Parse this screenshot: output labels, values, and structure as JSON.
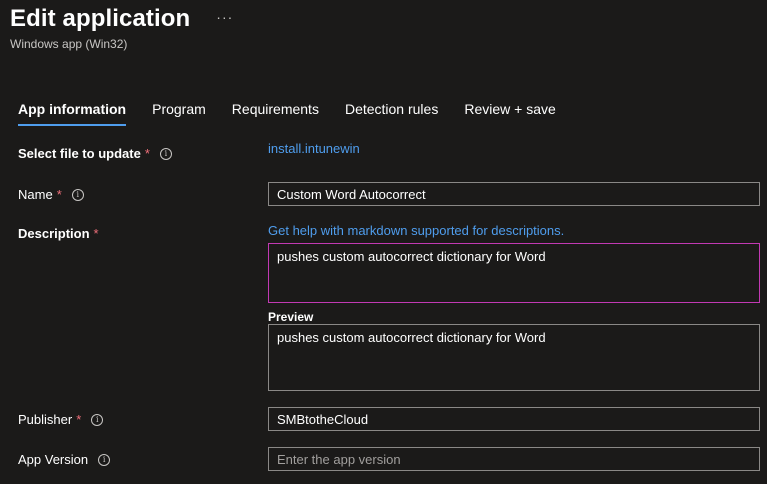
{
  "header": {
    "title": "Edit application",
    "more_label": "···",
    "subtitle": "Windows app (Win32)"
  },
  "tabs": [
    {
      "label": "App information",
      "active": true
    },
    {
      "label": "Program",
      "active": false
    },
    {
      "label": "Requirements",
      "active": false
    },
    {
      "label": "Detection rules",
      "active": false
    },
    {
      "label": "Review + save",
      "active": false
    }
  ],
  "form": {
    "select_file": {
      "label": "Select file to update",
      "required_mark": "*",
      "value": "install.intunewin"
    },
    "name": {
      "label": "Name",
      "required_mark": "*",
      "value": "Custom Word Autocorrect"
    },
    "description": {
      "label": "Description",
      "required_mark": "*",
      "help_link": "Get help with markdown supported for descriptions.",
      "value": "pushes custom autocorrect dictionary for Word",
      "preview_label": "Preview",
      "preview_value": "pushes custom autocorrect dictionary for Word"
    },
    "publisher": {
      "label": "Publisher",
      "required_mark": "*",
      "value": "SMBtotheCloud"
    },
    "app_version": {
      "label": "App Version",
      "value": "",
      "placeholder": "Enter the app version"
    }
  },
  "icons": {
    "info": "info-icon",
    "info_glyph": "i",
    "more": "more-icon"
  },
  "colors": {
    "background": "#1b1a19",
    "accent": "#4f9ded",
    "required": "#f1707b",
    "focus_border": "#c239b3"
  }
}
